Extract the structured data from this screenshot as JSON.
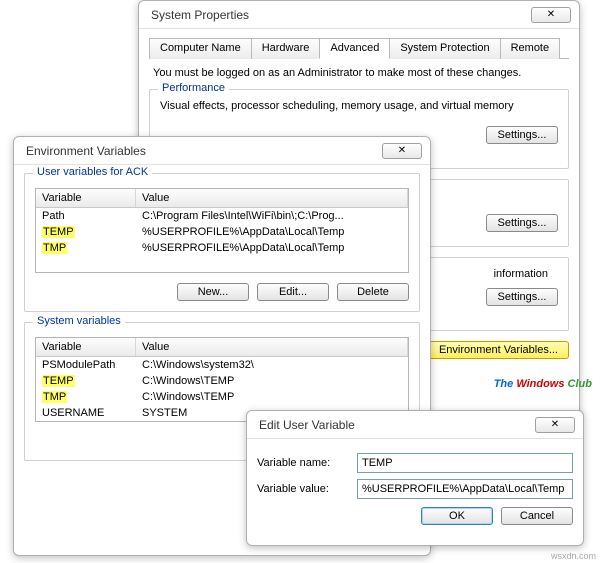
{
  "sysprops": {
    "title": "System Properties",
    "tabs": [
      "Computer Name",
      "Hardware",
      "Advanced",
      "System Protection",
      "Remote"
    ],
    "active_tab": 2,
    "note": "You must be logged on as an Administrator to make most of these changes.",
    "perf": {
      "legend": "Performance",
      "desc": "Visual effects, processor scheduling, memory usage, and virtual memory",
      "settings": "Settings..."
    },
    "profiles": {
      "settings": "Settings..."
    },
    "startup": {
      "desc_frag": "information",
      "settings": "Settings..."
    },
    "env_btn": "Environment Variables..."
  },
  "envvars": {
    "title": "Environment Variables",
    "user_legend": "User variables for ACK",
    "headers": {
      "var": "Variable",
      "val": "Value"
    },
    "user_rows": [
      {
        "var": "Path",
        "val": "C:\\Program Files\\Intel\\WiFi\\bin\\;C:\\Prog...",
        "hl": false
      },
      {
        "var": "TEMP",
        "val": "%USERPROFILE%\\AppData\\Local\\Temp",
        "hl": true
      },
      {
        "var": "TMP",
        "val": "%USERPROFILE%\\AppData\\Local\\Temp",
        "hl": true
      }
    ],
    "sys_legend": "System variables",
    "sys_rows": [
      {
        "var": "PSModulePath",
        "val": "C:\\Windows\\system32\\",
        "hl": false
      },
      {
        "var": "TEMP",
        "val": "C:\\Windows\\TEMP",
        "hl": true
      },
      {
        "var": "TMP",
        "val": "C:\\Windows\\TEMP",
        "hl": true
      },
      {
        "var": "USERNAME",
        "val": "SYSTEM",
        "hl": false
      }
    ],
    "buttons": {
      "new": "New...",
      "edit": "Edit...",
      "delete": "Delete"
    }
  },
  "edituser": {
    "title": "Edit User Variable",
    "name_label": "Variable name:",
    "name_value": "TEMP",
    "value_label": "Variable value:",
    "value_value": "%USERPROFILE%\\AppData\\Local\\Temp",
    "ok": "OK",
    "cancel": "Cancel"
  },
  "watermark": "wsxdn.com",
  "logo": {
    "a": "The ",
    "b": "Windows ",
    "c": "Club"
  }
}
